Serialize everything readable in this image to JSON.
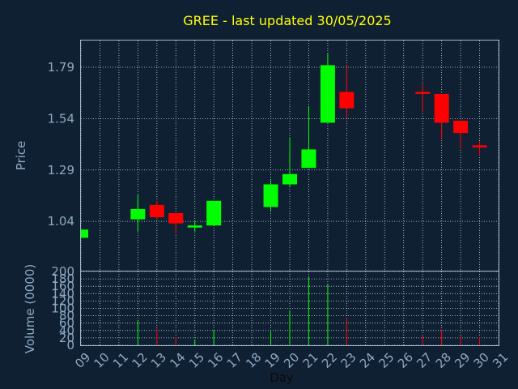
{
  "colors": {
    "background": "#0f2033",
    "frame": "#9fb7cc",
    "grid": "#c8d6e3",
    "label": "#8fa9c0",
    "title": "#ffff00",
    "up": "#00ff00",
    "down": "#ff0000"
  },
  "chart_data": [
    {
      "type": "candlestick",
      "title": "GREE - last updated 30/05/2025",
      "ylabel": "Price",
      "ylim": [
        0.8,
        1.92
      ],
      "yticks": [
        "1.04",
        "1.29",
        "1.54",
        "1.79"
      ],
      "grid": true,
      "candles": [
        {
          "day": "09",
          "open": 0.96,
          "high": 1.0,
          "low": 0.96,
          "close": 1.0
        },
        {
          "day": "12",
          "open": 1.05,
          "high": 1.17,
          "low": 0.99,
          "close": 1.1
        },
        {
          "day": "13",
          "open": 1.12,
          "high": 1.14,
          "low": 1.05,
          "close": 1.06
        },
        {
          "day": "14",
          "open": 1.08,
          "high": 1.08,
          "low": 0.98,
          "close": 1.03
        },
        {
          "day": "15",
          "open": 1.01,
          "high": 1.04,
          "low": 0.99,
          "close": 1.02
        },
        {
          "day": "16",
          "open": 1.02,
          "high": 1.14,
          "low": 1.02,
          "close": 1.14
        },
        {
          "day": "19",
          "open": 1.11,
          "high": 1.24,
          "low": 1.09,
          "close": 1.22
        },
        {
          "day": "20",
          "open": 1.22,
          "high": 1.45,
          "low": 1.21,
          "close": 1.27
        },
        {
          "day": "21",
          "open": 1.3,
          "high": 1.6,
          "low": 1.3,
          "close": 1.39
        },
        {
          "day": "22",
          "open": 1.52,
          "high": 1.86,
          "low": 1.52,
          "close": 1.8
        },
        {
          "day": "23",
          "open": 1.67,
          "high": 1.8,
          "low": 1.54,
          "close": 1.59
        },
        {
          "day": "27",
          "open": 1.67,
          "high": 1.71,
          "low": 1.57,
          "close": 1.66
        },
        {
          "day": "28",
          "open": 1.66,
          "high": 1.66,
          "low": 1.44,
          "close": 1.52
        },
        {
          "day": "29",
          "open": 1.53,
          "high": 1.53,
          "low": 1.39,
          "close": 1.47
        },
        {
          "day": "30",
          "open": 1.41,
          "high": 1.43,
          "low": 1.36,
          "close": 1.4
        }
      ]
    },
    {
      "type": "bar",
      "xlabel": "Day",
      "ylabel": "Volume (0000)",
      "ylim": [
        0,
        200
      ],
      "yticks": [
        "0",
        "20",
        "40",
        "60",
        "80",
        "100",
        "120",
        "140",
        "160",
        "180",
        "200"
      ],
      "categories": [
        "09",
        "10",
        "11",
        "12",
        "13",
        "14",
        "15",
        "16",
        "17",
        "18",
        "19",
        "20",
        "21",
        "22",
        "23",
        "24",
        "25",
        "26",
        "27",
        "28",
        "29",
        "30",
        "31"
      ],
      "grid": true,
      "bars": [
        {
          "day": "12",
          "value": 65,
          "direction": "up"
        },
        {
          "day": "13",
          "value": 45,
          "direction": "down"
        },
        {
          "day": "14",
          "value": 22,
          "direction": "down"
        },
        {
          "day": "15",
          "value": 15,
          "direction": "up"
        },
        {
          "day": "16",
          "value": 40,
          "direction": "up"
        },
        {
          "day": "19",
          "value": 38,
          "direction": "up"
        },
        {
          "day": "20",
          "value": 95,
          "direction": "up"
        },
        {
          "day": "21",
          "value": 185,
          "direction": "up"
        },
        {
          "day": "22",
          "value": 165,
          "direction": "up"
        },
        {
          "day": "23",
          "value": 75,
          "direction": "down"
        },
        {
          "day": "27",
          "value": 28,
          "direction": "down"
        },
        {
          "day": "28",
          "value": 42,
          "direction": "down"
        },
        {
          "day": "29",
          "value": 26,
          "direction": "down"
        },
        {
          "day": "30",
          "value": 22,
          "direction": "down"
        }
      ]
    }
  ]
}
